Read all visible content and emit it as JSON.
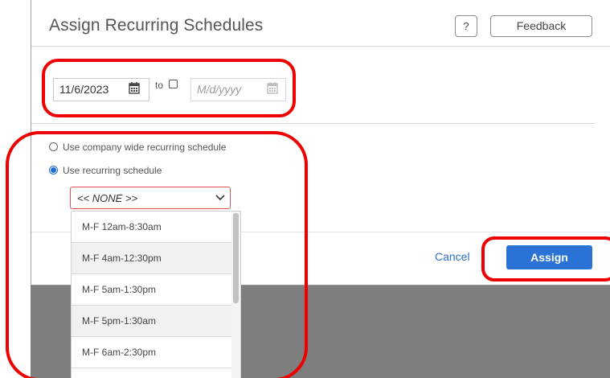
{
  "dialog": {
    "title": "Assign Recurring Schedules",
    "help_label": "?",
    "feedback_label": "Feedback"
  },
  "date_range": {
    "start_value": "11/6/2023",
    "to_label": "to",
    "end_placeholder": "M/d/yyyy",
    "end_checked": false
  },
  "schedule_options": {
    "company_wide_label": "Use company wide recurring schedule",
    "recurring_label": "Use recurring schedule",
    "selected_option": "recurring"
  },
  "schedule_select": {
    "value": "<< NONE >>",
    "options": [
      "M-F 12am-8:30am",
      "M-F 4am-12:30pm",
      "M-F 5am-1:30pm",
      "M-F 5pm-1:30am",
      "M-F 6am-2:30pm"
    ]
  },
  "footer": {
    "cancel_label": "Cancel",
    "assign_label": "Assign"
  },
  "colors": {
    "primary": "#2b72d6",
    "highlight": "#ee0000",
    "link": "#2b72c9"
  },
  "icons": [
    "calendar-icon",
    "checkbox-icon",
    "radio-icon",
    "chevron-down-icon"
  ]
}
